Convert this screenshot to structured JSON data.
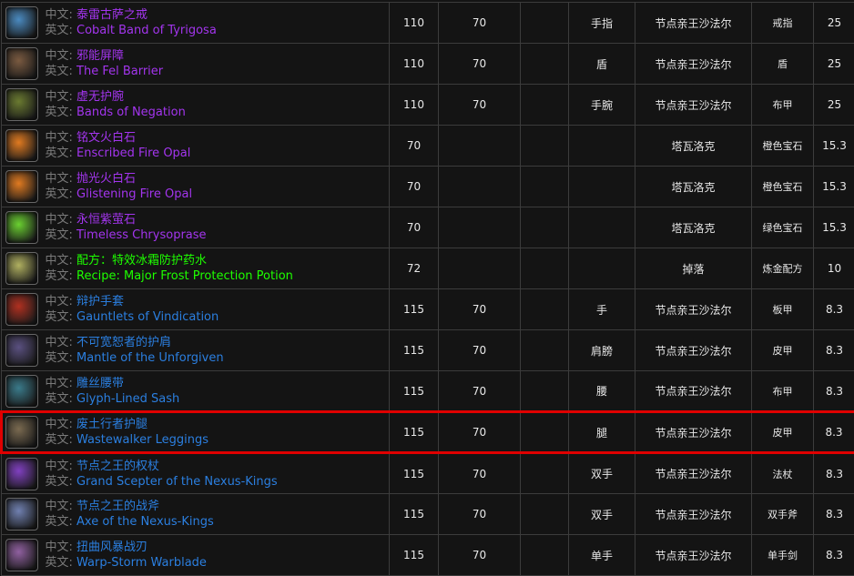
{
  "labels": {
    "cn": "中文: ",
    "en": "英文: "
  },
  "colors": {
    "epic": "#a335ee",
    "rare": "#2b7fe0",
    "uncommon": "#1eff00"
  },
  "rows": [
    {
      "icon": "ring-icon",
      "iconColor": "#4a8ac0",
      "cn": "泰雷古萨之戒",
      "en": "Cobalt Band of Tyrigosa",
      "quality": "epic",
      "ilvl": "110",
      "req": "70",
      "extra": "",
      "slot": "手指",
      "source": "节点亲王沙法尔",
      "type": "戒指",
      "pct": "25"
    },
    {
      "icon": "shield-icon",
      "iconColor": "#7a5a40",
      "cn": "邪能屏障",
      "en": "The Fel Barrier",
      "quality": "epic",
      "ilvl": "110",
      "req": "70",
      "extra": "",
      "slot": "盾",
      "source": "节点亲王沙法尔",
      "type": "盾",
      "pct": "25"
    },
    {
      "icon": "bracer-icon",
      "iconColor": "#6a7a30",
      "cn": "虚无护腕",
      "en": "Bands of Negation",
      "quality": "epic",
      "ilvl": "110",
      "req": "70",
      "extra": "",
      "slot": "手腕",
      "source": "节点亲王沙法尔",
      "type": "布甲",
      "pct": "25"
    },
    {
      "icon": "gem-orange-icon",
      "iconColor": "#e07a20",
      "cn": "铭文火白石",
      "en": "Enscribed Fire Opal",
      "quality": "epic",
      "ilvl": "70",
      "req": "",
      "extra": "",
      "slot": "",
      "source": "塔瓦洛克",
      "type": "橙色宝石",
      "pct": "15.3"
    },
    {
      "icon": "gem-orange-icon",
      "iconColor": "#e07a20",
      "cn": "抛光火白石",
      "en": "Glistening Fire Opal",
      "quality": "epic",
      "ilvl": "70",
      "req": "",
      "extra": "",
      "slot": "",
      "source": "塔瓦洛克",
      "type": "橙色宝石",
      "pct": "15.3"
    },
    {
      "icon": "gem-green-icon",
      "iconColor": "#6ad030",
      "cn": "永恒紫萤石",
      "en": "Timeless Chrysoprase",
      "quality": "epic",
      "ilvl": "70",
      "req": "",
      "extra": "",
      "slot": "",
      "source": "塔瓦洛克",
      "type": "绿色宝石",
      "pct": "15.3"
    },
    {
      "icon": "recipe-icon",
      "iconColor": "#b0b060",
      "cn": "配方：特效冰霜防护药水",
      "en": "Recipe: Major Frost Protection Potion",
      "quality": "uncommon",
      "ilvl": "72",
      "req": "",
      "extra": "",
      "slot": "",
      "source": "掉落",
      "type": "炼金配方",
      "pct": "10"
    },
    {
      "icon": "gauntlet-icon",
      "iconColor": "#b03020",
      "cn": "辩护手套",
      "en": "Gauntlets of Vindication",
      "quality": "rare",
      "ilvl": "115",
      "req": "70",
      "extra": "",
      "slot": "手",
      "source": "节点亲王沙法尔",
      "type": "板甲",
      "pct": "8.3"
    },
    {
      "icon": "shoulder-icon",
      "iconColor": "#5a5080",
      "cn": "不可宽恕者的护肩",
      "en": "Mantle of the Unforgiven",
      "quality": "rare",
      "ilvl": "115",
      "req": "70",
      "extra": "",
      "slot": "肩膀",
      "source": "节点亲王沙法尔",
      "type": "皮甲",
      "pct": "8.3"
    },
    {
      "icon": "belt-icon",
      "iconColor": "#3a7a8a",
      "cn": "雕丝腰带",
      "en": "Glyph-Lined Sash",
      "quality": "rare",
      "ilvl": "115",
      "req": "70",
      "extra": "",
      "slot": "腰",
      "source": "节点亲王沙法尔",
      "type": "布甲",
      "pct": "8.3"
    },
    {
      "icon": "leggings-icon",
      "iconColor": "#7a6a50",
      "cn": "废土行者护腿",
      "en": "Wastewalker Leggings",
      "quality": "rare",
      "ilvl": "115",
      "req": "70",
      "extra": "",
      "slot": "腿",
      "source": "节点亲王沙法尔",
      "type": "皮甲",
      "pct": "8.3",
      "highlight": true
    },
    {
      "icon": "staff-icon",
      "iconColor": "#8040c0",
      "cn": "节点之王的权杖",
      "en": "Grand Scepter of the Nexus-Kings",
      "quality": "rare",
      "ilvl": "115",
      "req": "70",
      "extra": "",
      "slot": "双手",
      "source": "节点亲王沙法尔",
      "type": "法杖",
      "pct": "8.3"
    },
    {
      "icon": "axe-icon",
      "iconColor": "#7080b0",
      "cn": "节点之王的战斧",
      "en": "Axe of the Nexus-Kings",
      "quality": "rare",
      "ilvl": "115",
      "req": "70",
      "extra": "",
      "slot": "双手",
      "source": "节点亲王沙法尔",
      "type": "双手斧",
      "pct": "8.3"
    },
    {
      "icon": "sword-icon",
      "iconColor": "#9060a0",
      "cn": "扭曲风暴战刃",
      "en": "Warp-Storm Warblade",
      "quality": "rare",
      "ilvl": "115",
      "req": "70",
      "extra": "",
      "slot": "单手",
      "source": "节点亲王沙法尔",
      "type": "单手剑",
      "pct": "8.3"
    }
  ]
}
